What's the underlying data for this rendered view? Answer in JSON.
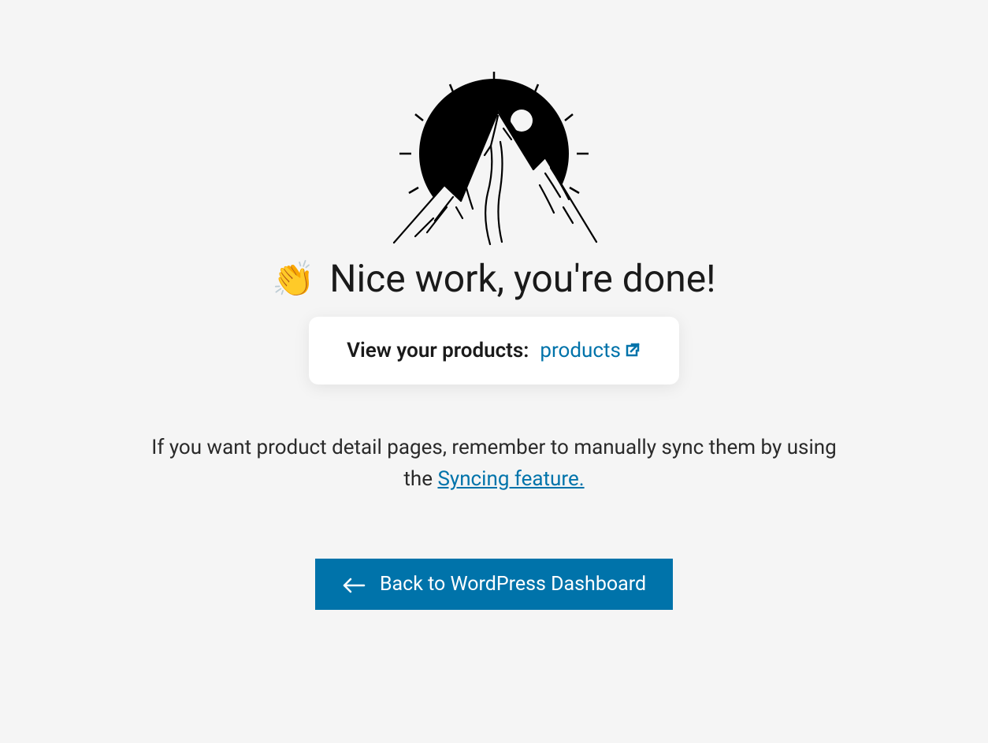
{
  "heading": {
    "emoji": "👏",
    "text": "Nice work, you're done!"
  },
  "card": {
    "label": "View your products:",
    "link_text": "products"
  },
  "description": {
    "part1": "If you want product detail pages, remember to manually sync them by using the ",
    "link_text": "Syncing feature."
  },
  "back_button": {
    "label": "Back to WordPress Dashboard"
  }
}
